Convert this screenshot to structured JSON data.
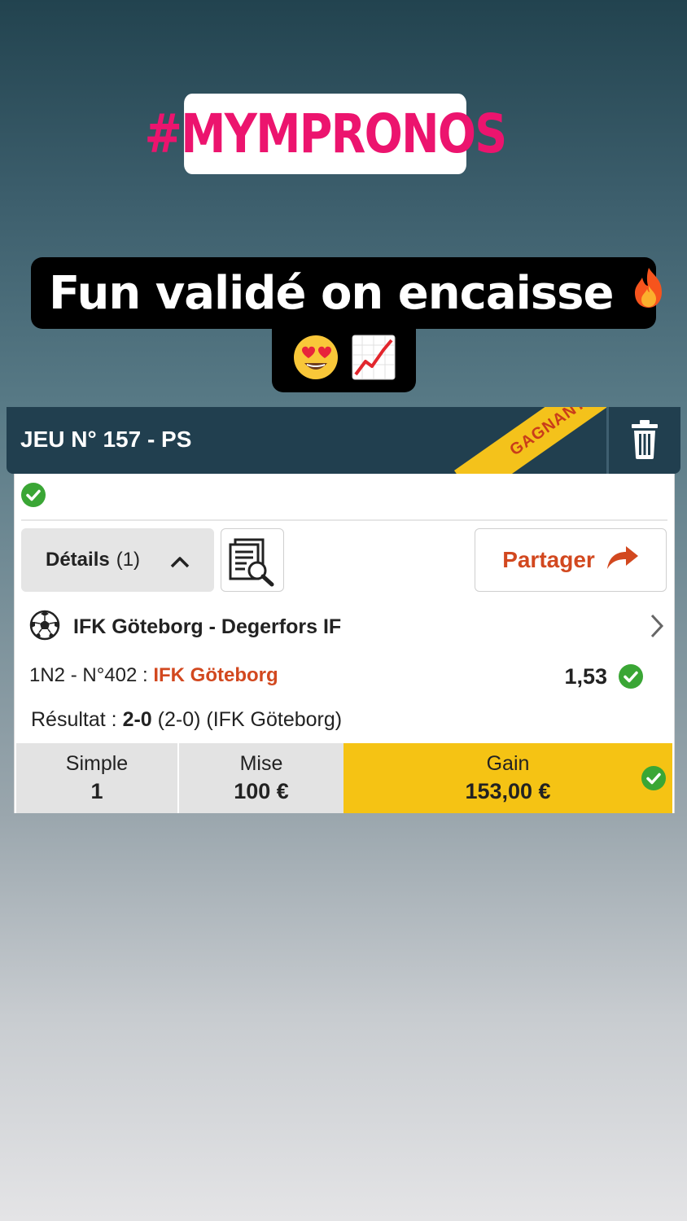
{
  "story": {
    "hashtag": "#MYMPRONOS",
    "caption_line1": "Fun validé on encaisse",
    "emoji_line1": "🔥",
    "emoji_line2": [
      "😍",
      "📈"
    ]
  },
  "card": {
    "title": "JEU N° 157 - PS",
    "status_ribbon": "GAGNANT",
    "details_label": "Détails",
    "details_count": "(1)",
    "share_label": "Partager",
    "match": "IFK Göteborg - Degerfors IF",
    "bet_prefix": "1N2 - N°402 : ",
    "bet_selection": "IFK Göteborg",
    "odds": "1,53",
    "result_label": "Résultat : ",
    "result_score": "2-0",
    "result_detail": " (2-0) (IFK Göteborg)",
    "footer": {
      "type_label": "Simple",
      "type_value": "1",
      "stake_label": "Mise",
      "stake_value": "100 €",
      "gain_label": "Gain",
      "gain_value": "153,00 €"
    }
  },
  "colors": {
    "header_bg": "#213f4f",
    "ribbon": "#f4c21b",
    "accent_orange": "#d2481f",
    "gain_bg": "#f5c314",
    "check_green": "#3aa635",
    "hashtag_pink": "#ec146e"
  }
}
